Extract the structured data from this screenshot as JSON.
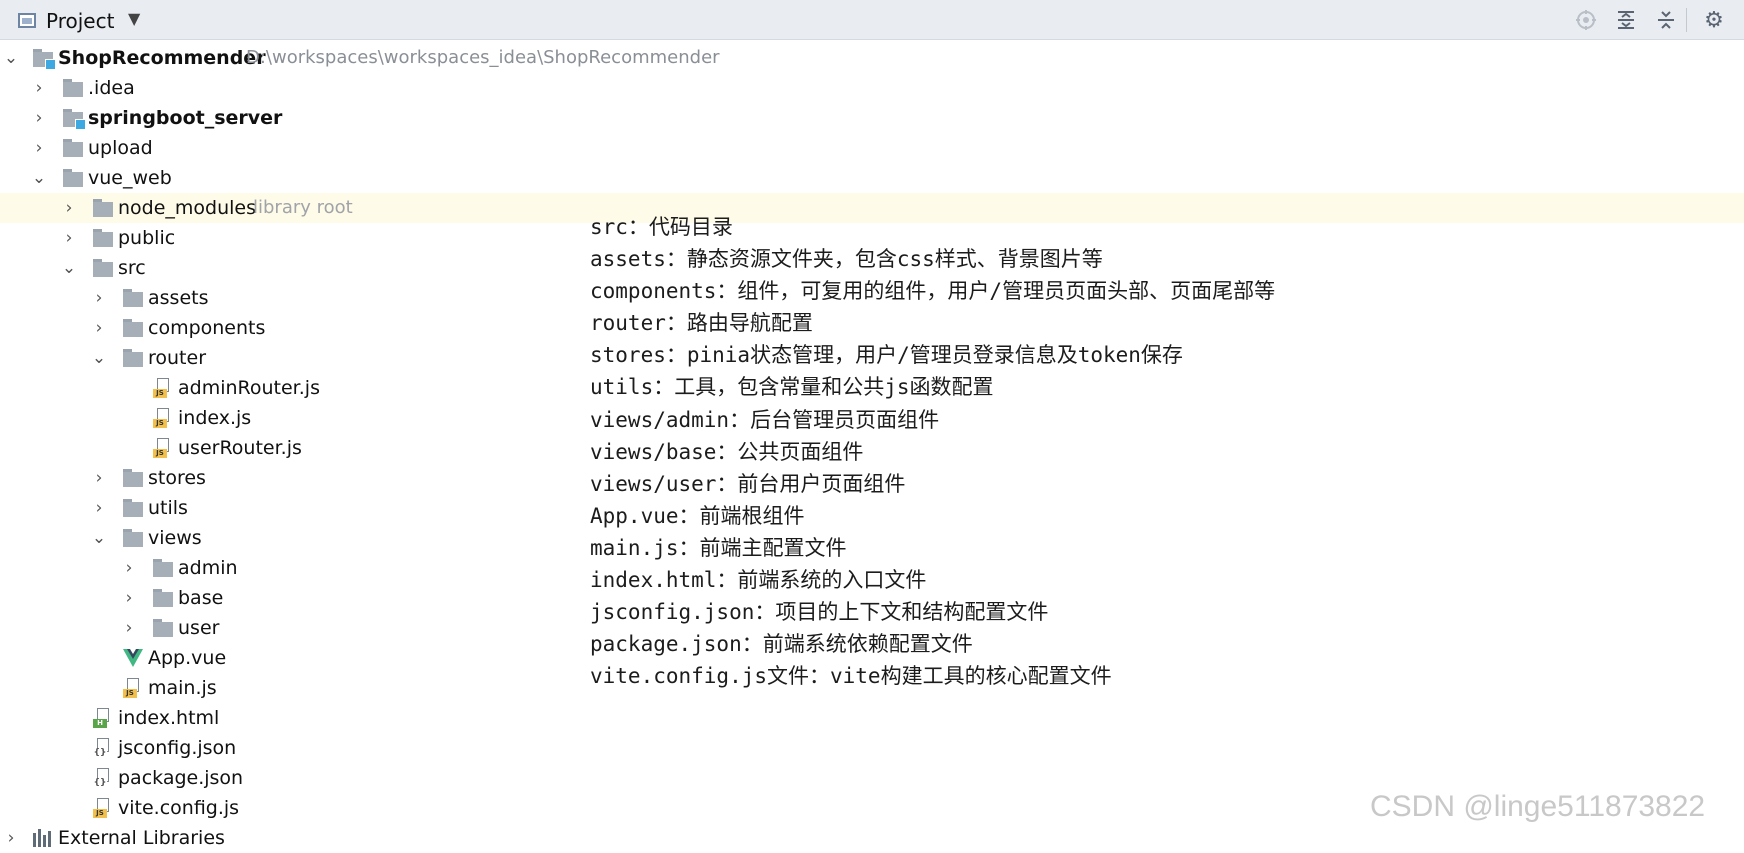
{
  "toolbar": {
    "title": "Project",
    "dropdown_icon": "chevron-down-icon",
    "buttons": [
      "locate-icon",
      "expand-all-icon",
      "collapse-all-icon",
      "settings-gear-icon"
    ]
  },
  "tree": {
    "root": {
      "name": "ShopRecommender",
      "path": "D:\\workspaces\\workspaces_idea\\ShopRecommender"
    },
    "items": [
      {
        "label": ".idea"
      },
      {
        "label": "springboot_server"
      },
      {
        "label": "upload"
      },
      {
        "label": "vue_web"
      },
      {
        "label": "node_modules",
        "hint": "library root"
      },
      {
        "label": "public"
      },
      {
        "label": "src"
      },
      {
        "label": "assets"
      },
      {
        "label": "components"
      },
      {
        "label": "router"
      },
      {
        "label": "adminRouter.js"
      },
      {
        "label": "index.js"
      },
      {
        "label": "userRouter.js"
      },
      {
        "label": "stores"
      },
      {
        "label": "utils"
      },
      {
        "label": "views"
      },
      {
        "label": "admin"
      },
      {
        "label": "base"
      },
      {
        "label": "user"
      },
      {
        "label": "App.vue"
      },
      {
        "label": "main.js"
      },
      {
        "label": "index.html"
      },
      {
        "label": "jsconfig.json"
      },
      {
        "label": "package.json"
      },
      {
        "label": "vite.config.js"
      },
      {
        "label": "External Libraries"
      }
    ]
  },
  "notes": [
    "src：代码目录",
    "assets：静态资源文件夹，包含css样式、背景图片等",
    "components：组件，可复用的组件，用户/管理员页面头部、页面尾部等",
    "router：路由导航配置",
    "stores：pinia状态管理，用户/管理员登录信息及token保存",
    "utils：工具，包含常量和公共js函数配置",
    "views/admin：后台管理员页面组件",
    "views/base：公共页面组件",
    "views/user：前台用户页面组件",
    "App.vue：前端根组件",
    "main.js：前端主配置文件",
    "index.html：前端系统的入口文件",
    "jsconfig.json：项目的上下文和结构配置文件",
    "package.json：前端系统依赖配置文件",
    "vite.config.js文件：vite构建工具的核心配置文件"
  ],
  "watermark": "CSDN @linge511873822"
}
